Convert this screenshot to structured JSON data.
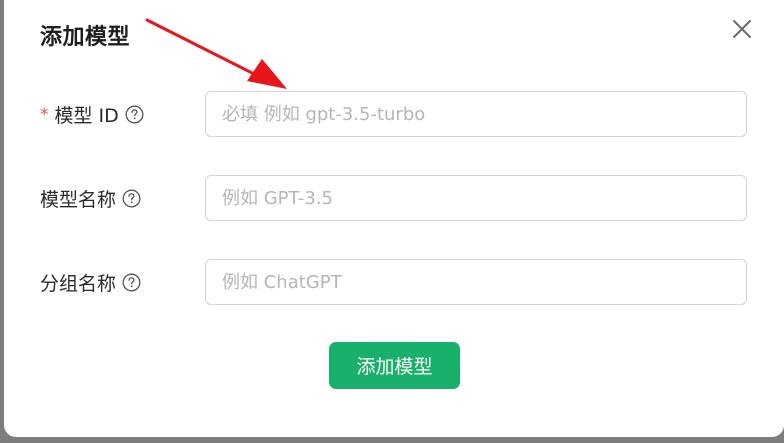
{
  "dialog": {
    "title": "添加模型",
    "close_icon": "close-icon"
  },
  "form": {
    "model_id": {
      "required_mark": "*",
      "label": "模型 ID",
      "placeholder": "必填 例如 gpt-3.5-turbo",
      "value": "",
      "help_icon": "question-circle-icon"
    },
    "model_name": {
      "label": "模型名称",
      "placeholder": "例如 GPT-3.5",
      "value": "",
      "help_icon": "question-circle-icon"
    },
    "group_name": {
      "label": "分组名称",
      "placeholder": "例如 ChatGPT",
      "value": "",
      "help_icon": "question-circle-icon"
    }
  },
  "actions": {
    "submit_label": "添加模型"
  },
  "colors": {
    "primary": "#18b06a",
    "required": "#e34d59",
    "annotation_arrow": "#e8161b"
  }
}
